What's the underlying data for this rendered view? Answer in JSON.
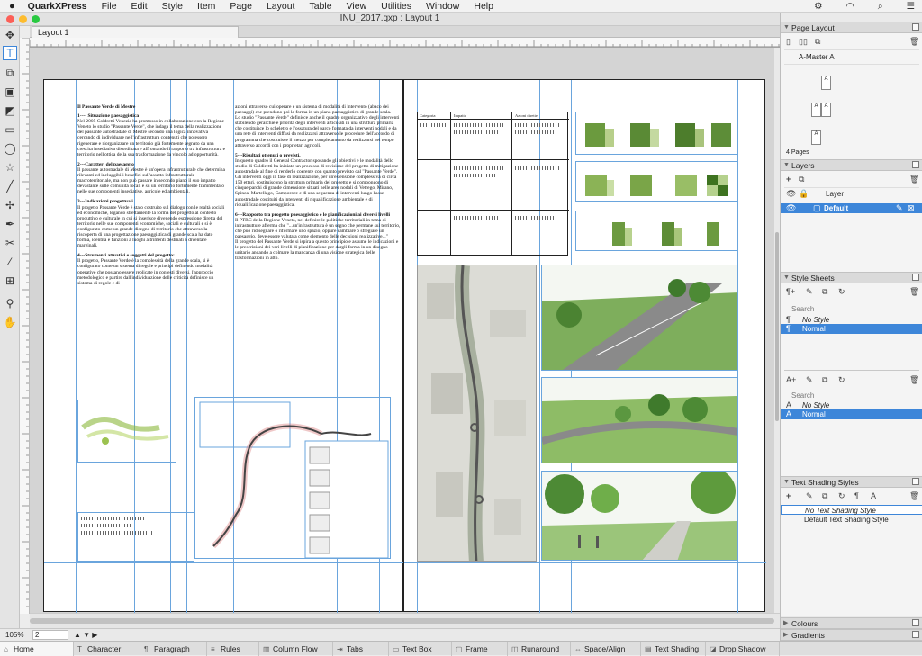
{
  "menubar": {
    "app": "QuarkXPress",
    "items": [
      "File",
      "Edit",
      "Style",
      "Item",
      "Page",
      "Layout",
      "Table",
      "View",
      "Utilities",
      "Window",
      "Help"
    ]
  },
  "window": {
    "title": "INU_2017.qxp : Layout 1",
    "layout_tab": "Layout 1"
  },
  "status": {
    "zoom": "105%",
    "page": "2"
  },
  "panels": {
    "page_layout": {
      "title": "Page Layout",
      "master": "A-Master A",
      "page_count": "4 Pages",
      "page_labels": [
        "A",
        "A",
        "A",
        "A"
      ]
    },
    "layers": {
      "title": "Layers",
      "column": "Layer",
      "rows": [
        "Default"
      ]
    },
    "style_sheets": {
      "title": "Style Sheets",
      "search": "Search",
      "paragraph": [
        "No Style",
        "Normal"
      ],
      "character": [
        "No Style",
        "Normal"
      ]
    },
    "text_shading": {
      "title": "Text Shading Styles",
      "rows": [
        "No Text Shading Style",
        "Default Text Shading Style"
      ]
    },
    "collapsed": [
      "Colours",
      "Gradients"
    ]
  },
  "bottom_tabs": [
    "Home",
    "Character",
    "Paragraph",
    "Rules",
    "Column Flow",
    "Tabs",
    "Text Box",
    "Frame",
    "Runaround",
    "Space/Align",
    "Text Shading",
    "Drop Shadow"
  ],
  "document": {
    "left_col1": {
      "h0": "Il Passante Verde di Mestre",
      "h1": "1---- Situazione paesaggistica",
      "p1": "Nel 2005  Coldretti Venezia ha promosso in collaborazione con la Regione Veneto lo studio \"Passante Verde\", che indaga il tema della realizzazione del passante autostradale di Mestre secondo una logica innovativa cercando di individuare nell'infrastruttura contenuti che potessero rigenerare e riorganizzare un territorio già fortemente segnato da una crescita insediativa disordinata e affrontando il rapporto tra infrastruttura e territorio nell'ottica della sua trasformazione da vincolo ad opportunità.",
      "h2": "2---Caratteri del paesaggio",
      "p2": "Il passante autostradale di Mestre è un'opera infrastrutturale che determina rilevanti ed ineluggibili benefici sull'assetto infrastrutturale macroterritoriale, ma non può passare in secondo piano il suo impatto devastante sulle comunità locali e su un territorio fortemente frammentato nelle sue componenti insediative, agricole ed ambientali.",
      "h3": "3---Indicazioni progettuali",
      "p3": "Il progetto Passante Verde è stato costruito sul dialogo con le realtà sociali ed economiche, legando strettamente la forma del progetto al contesto produttivo e culturale in cui si inserisce divenendo  espressione diretta del territorio nelle sue componenti economiche, sociali e culturali  e si è configurato come un grande disegno di territorio che attraverso la riscoperta di una progettazione paesaggistica di grande scala ha dato forma, identità e funzioni a luoghi altrimenti destinati a diventare marginali.",
      "h4": "4---Strumenti attuativi e soggetti del progetto:",
      "p4": "Il progetto, Passante Verde è la complessità della grande scala, si è configurato come un sistema di regole e principi definendo modalità operative che possano essere replicate in contesti diversi, l'approccio metodologico e partire dall'individuazione delle criticità definisce un sistema di regole e di"
    },
    "left_col2": {
      "p1": "azioni attraverso cui operare e un sistema di modalità di intervento (abaco dei paesaggi) che prendono poi la forma in un piano paesaggistico di grande scala.",
      "p2": "Lo studio \"Passante Verde\" definisce anche il quadro organizzativo degli interventi stabilendo gerarchie e priorità degli interventi articolati in una struttura primaria che costituisce lo scheletro e l'ossatura del parco formata da interventi nodali e da una rete di interventi diffusi da realizzarsi attraverso le procedure dell'accordo di programma che costituisce il mezzo per completamento da realizzarsi nel tempo attraverso accordi con i proprietari agricoli.",
      "h5": "5---Risultati  ottenuti  o previsti.",
      "p5": "In questo quadro il General Contractor sposando gli obiettivi e le modalità dello studio di Coldiretti ha iniziato un processo di revisione del progetto di mitigazione autostradale al fine di renderlo coerente con quanto previsto dal \"Passante Verde\". Gli interventi oggi in fase di realizzazione, per un'estensione complessiva di circa 150 ettari, costituiscono la struttura primaria del progetto e si compongono di cinque parchi di grande dimensione situati nelle aree nodali di Vetrego, Mirano, Spinea, Martellago, Camporoce e di una sequenza di interventi lungo l'asse autostradale costituiti da interventi di riqualificazione ambientale e di riqualificazione paesaggistica.",
      "h6": "6---Rapporto tra progetto paesaggistico e le  pianificazioni ai diversi livelli",
      "p6": "Il PTRC della Regione Veneto, nel definire le politiche territoriali in tema di infrastrutture  afferma che \"...un'infrastruttura è un segno che permane sul territorio, che può ridisegnare o riformare uno spazio, oppure cambiare o sfregiare un paesaggio, deve essere valutata come elemento delle decisioni realizzative...\"",
      "p7": "Il progetto del Passante Verde si ispira a questo principio e assume le indicazioni e le prescrizioni dei vari livelli di pianificazione per dargli forma in un disegno unitario andando a colmare la mancanza di una visione strategica delle trasformazioni in atto."
    },
    "table_headers": [
      "Categoria",
      "Impatto",
      "Azioni dirette"
    ]
  },
  "colors": {
    "accent": "#3d86d9",
    "guide": "#6aa5dd",
    "page": "#ffffff",
    "pasteboard": "#d4d4d4"
  }
}
